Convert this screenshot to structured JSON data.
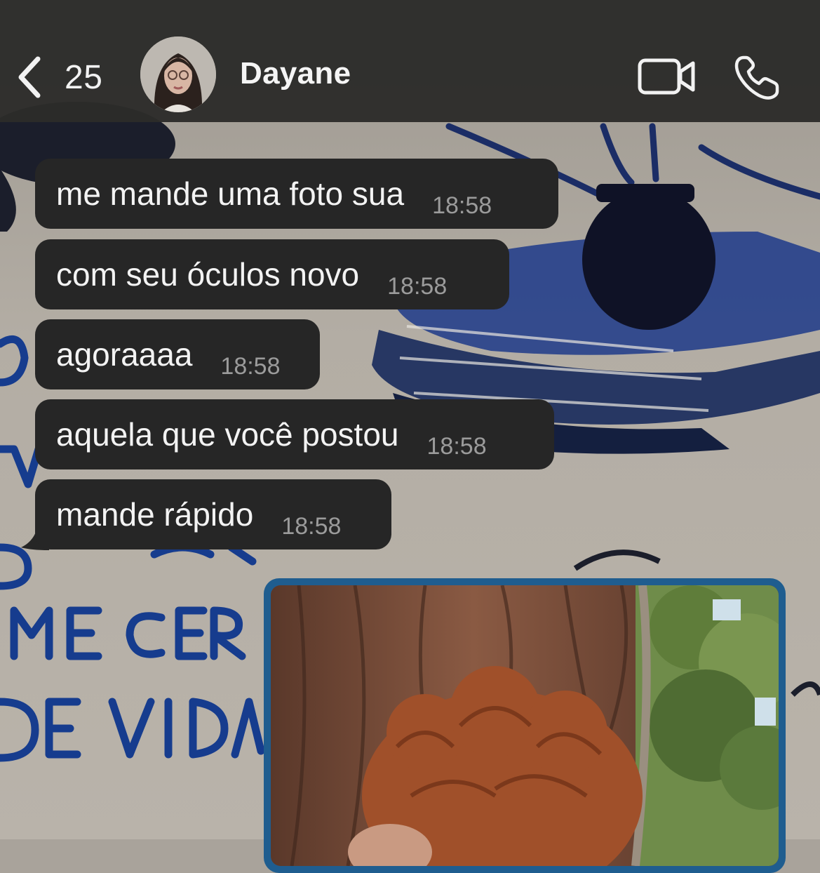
{
  "header": {
    "back_count": "25",
    "contact_name": "Dayane"
  },
  "messages": [
    {
      "text": "me mande uma foto sua",
      "time": "18:58"
    },
    {
      "text": "com seu óculos novo",
      "time": "18:58"
    },
    {
      "text": "agoraaaa",
      "time": "18:58"
    },
    {
      "text": "aquela que você postou",
      "time": "18:58"
    },
    {
      "text": "mande rápido",
      "time": "18:58"
    }
  ],
  "colors": {
    "header_bg": "#2c2c2a",
    "bubble_bg": "#262626",
    "photo_border": "#1f5d8f"
  },
  "icons": [
    "chevron-left-icon",
    "video-camera-icon",
    "phone-icon"
  ]
}
